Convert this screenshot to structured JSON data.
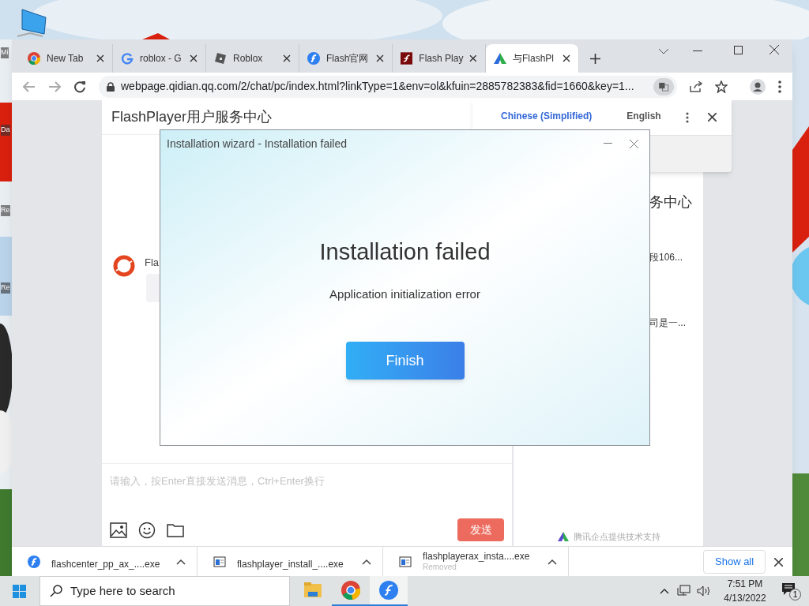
{
  "desktop": {
    "icon_labels": [
      "Mi",
      "Da",
      "Re",
      "Re"
    ]
  },
  "browser": {
    "tabs": [
      {
        "label": "New Tab",
        "kind": "chrome",
        "selected": false
      },
      {
        "label": "roblox - G",
        "kind": "google",
        "selected": false
      },
      {
        "label": "Roblox",
        "kind": "roblox",
        "selected": false
      },
      {
        "label": "Flash官网",
        "kind": "flash",
        "selected": false
      },
      {
        "label": "Flash Play",
        "kind": "flashred",
        "selected": false
      },
      {
        "label": "与FlashPl",
        "kind": "qidian",
        "selected": true
      }
    ],
    "address": "webpage.qidian.qq.com/2/chat/pc/index.html?linkType=1&env=ol&kfuin=2885782383&fid=1660&key=1...",
    "translate_popup": {
      "tabs": [
        {
          "label": "Chinese (Simplified)",
          "selected": true
        },
        {
          "label": "English",
          "selected": false
        }
      ]
    },
    "chat": {
      "title": "FlashPlayer用户服务中心",
      "sender": "Fla",
      "input": {
        "placeholder": "请输入，按Enter直接发送消息，Ctrl+Enter换行"
      },
      "send_button": "发送"
    },
    "side_panel": {
      "heading": "务中心",
      "lines": [
        "段106...",
        "司是一..."
      ],
      "footer": "腾讯企点提供技术支持"
    },
    "downloads": [
      {
        "file": "flashcenter_pp_ax_....exe",
        "kind": "flash"
      },
      {
        "file": "flashplayer_install_....exe",
        "kind": "installer"
      },
      {
        "file": "flashplayerax_insta....exe",
        "kind": "installer",
        "status": "Removed"
      }
    ],
    "show_all": "Show all"
  },
  "dialog": {
    "title": "Installation wizard - Installation failed",
    "heading": "Installation failed",
    "message": "Application initialization error",
    "button": "Finish"
  },
  "taskbar": {
    "search_placeholder": "Type here to search",
    "apps": [
      {
        "kind": "folder",
        "running": false,
        "selected": false
      },
      {
        "kind": "chrome",
        "running": true,
        "selected": false
      },
      {
        "kind": "flash",
        "running": true,
        "selected": true
      }
    ],
    "time": "7:51 PM",
    "date": "4/13/2022",
    "notifications": "1"
  }
}
